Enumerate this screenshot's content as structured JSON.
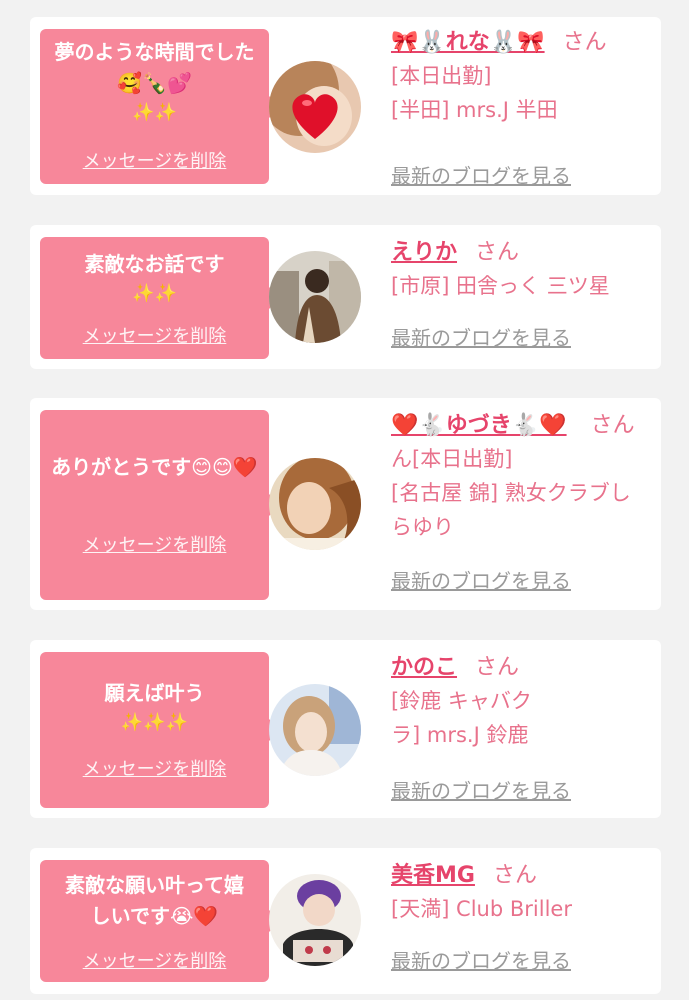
{
  "delete_label": "メッセージを削除",
  "san_label": "さん",
  "blog_label": "最新のブログを見る",
  "cards": [
    {
      "message": "夢のような時間でした🥰🍾💕",
      "message_emoji": "✨✨",
      "name": "🎀🐰れな🐰🎀",
      "line1": "[本日出勤]",
      "line2": "[半田] mrs.J 半田"
    },
    {
      "message": "素敵なお話です",
      "message_emoji": "✨✨",
      "name": "えりか",
      "line1": "[市原] 田舎っく 三ツ星",
      "line2": ""
    },
    {
      "message": "ありがとうです😊😊❤️",
      "message_emoji": "",
      "name": "❤️🐇ゆづき🐇❤️",
      "line1": "ん[本日出勤]",
      "line2": "[名古屋 錦] 熟女クラブしらゆり"
    },
    {
      "message": "願えば叶う",
      "message_emoji": "✨✨✨",
      "name": "かのこ",
      "line1": "[鈴鹿 キャバクラ] mrs.J 鈴鹿",
      "line2": ""
    },
    {
      "message": "素敵な願い叶って嬉しいです😭❤️",
      "message_emoji": "",
      "name": "美香MG",
      "line1": "[天満] Club Briller",
      "line2": ""
    }
  ],
  "colors": {
    "bubble": "#f7879a",
    "name": "#e6446b",
    "text": "#e8728c",
    "link_gray": "#9a9a9a",
    "background": "#f2f2f2"
  }
}
